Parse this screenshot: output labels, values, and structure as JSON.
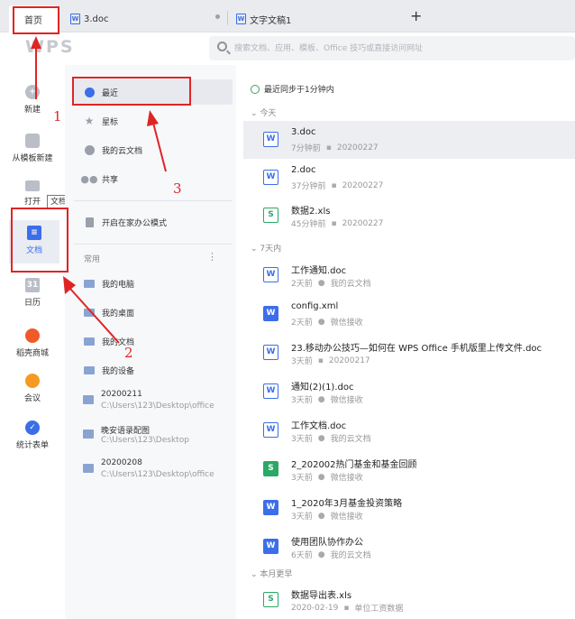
{
  "tabs": {
    "home": "首页",
    "doc1": "3.doc",
    "doc2": "文字文稿1",
    "doc_icon": "W",
    "new_tab_symbol": "+"
  },
  "header": {
    "logo": "WPS",
    "search_placeholder": "搜索文档、应用、模板、Office 技巧或直接访问网址"
  },
  "rail": {
    "new": "新建",
    "new_from_template": "从模板新建",
    "open": "打开",
    "docs": "文档",
    "calendar": "日历",
    "daoke_mall": "稻壳商城",
    "meeting": "会议",
    "forms": "统计表单",
    "tooltip": "文档"
  },
  "nav": {
    "recent": "最近",
    "starred": "星标",
    "cloud_docs": "我的云文档",
    "shared": "共享",
    "home_office": "开启在家办公模式",
    "common_section": "常用",
    "more_symbol": "⋮",
    "my_computer": "我的电脑",
    "my_desktop": "我的桌面",
    "my_documents": "我的文档",
    "my_devices": "我的设备",
    "folders": [
      {
        "name": "20200211",
        "path": "C:\\Users\\123\\Desktop\\office"
      },
      {
        "name": "晚安语录配图",
        "path": "C:\\Users\\123\\Desktop"
      },
      {
        "name": "20200208",
        "path": "C:\\Users\\123\\Desktop\\office"
      }
    ]
  },
  "main": {
    "sync_status": "最近同步于1分钟内",
    "groups": {
      "today": "今天",
      "week": "7天内",
      "month": "本月更早"
    },
    "files": [
      {
        "name": "3.doc",
        "time": "7分钟前",
        "source": "20200227",
        "icon": "W"
      },
      {
        "name": "2.doc",
        "time": "37分钟前",
        "source": "20200227",
        "icon": "W"
      },
      {
        "name": "数据2.xls",
        "time": "45分钟前",
        "source": "20200227",
        "icon": "S"
      },
      {
        "name": "工作通知.doc",
        "time": "2天前",
        "source": "我的云文档",
        "icon": "W"
      },
      {
        "name": "config.xml",
        "time": "2天前",
        "source": "微信接收",
        "icon": "W"
      },
      {
        "name": "23.移动办公技巧—如何在 WPS Office 手机版里上传文件.doc",
        "time": "3天前",
        "source": "20200217",
        "icon": "W"
      },
      {
        "name": "通知(2)(1).doc",
        "time": "3天前",
        "source": "微信接收",
        "icon": "W"
      },
      {
        "name": "工作文档.doc",
        "time": "3天前",
        "source": "我的云文档",
        "icon": "W"
      },
      {
        "name": "2_202002热门基金和基金回顾",
        "time": "3天前",
        "source": "微信接收",
        "icon": "S"
      },
      {
        "name": "1_2020年3月基金投资策略",
        "time": "3天前",
        "source": "微信接收",
        "icon": "W"
      },
      {
        "name": "使用团队协作办公",
        "time": "6天前",
        "source": "我的云文档",
        "icon": "W"
      },
      {
        "name": "数据导出表.xls",
        "time": "2020-02-19",
        "source": "单位工资数据",
        "icon": "S"
      }
    ]
  },
  "annotations": {
    "n1": "1",
    "n2": "2",
    "n3": "3"
  },
  "colors": {
    "accent": "#3b6ee8",
    "sheet_green": "#2aa866",
    "annotation_red": "#e02424"
  }
}
